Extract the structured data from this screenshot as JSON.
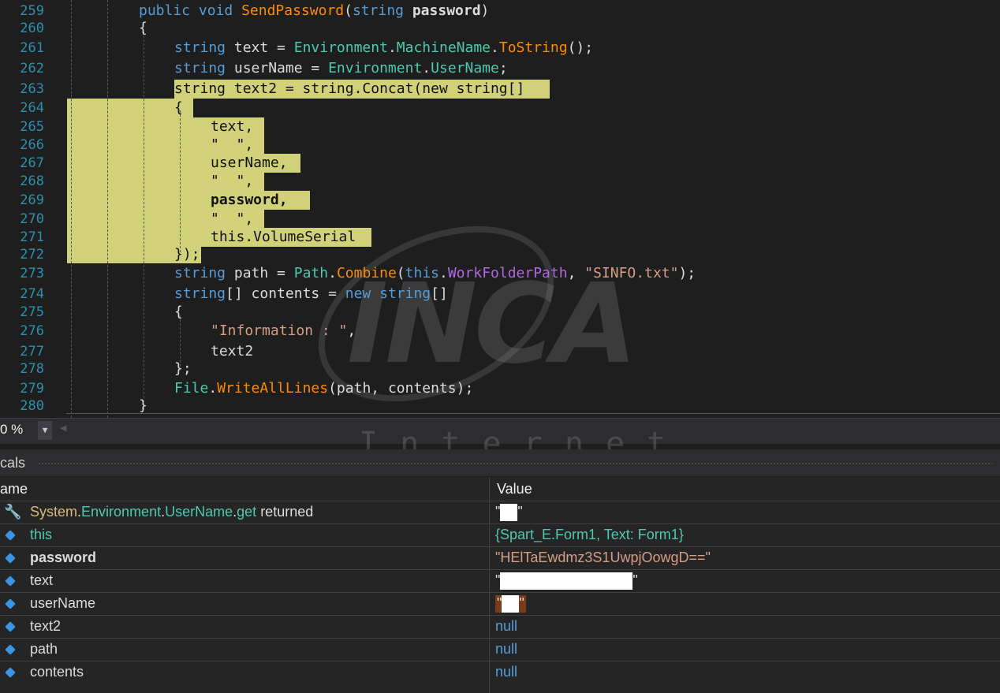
{
  "editor": {
    "lines": [
      {
        "n": "259"
      },
      {
        "n": "260"
      },
      {
        "n": "261"
      },
      {
        "n": "262"
      },
      {
        "n": "263"
      },
      {
        "n": "264"
      },
      {
        "n": "265"
      },
      {
        "n": "266"
      },
      {
        "n": "267"
      },
      {
        "n": "268"
      },
      {
        "n": "269"
      },
      {
        "n": "270"
      },
      {
        "n": "271"
      },
      {
        "n": "272"
      },
      {
        "n": "273"
      },
      {
        "n": "274"
      },
      {
        "n": "275"
      },
      {
        "n": "276"
      },
      {
        "n": "277"
      },
      {
        "n": "278"
      },
      {
        "n": "279"
      },
      {
        "n": "280"
      }
    ]
  },
  "watermark": {
    "logo": "INCA",
    "sub": "I.n.t.e.r.n.e.t"
  },
  "status": {
    "zoom": "0 %"
  },
  "locals": {
    "title": "cals",
    "col_name": "ame",
    "col_value": "Value",
    "rows": [
      {
        "name": "System.Environment.UserName.get returned",
        "value": "\"\""
      },
      {
        "name": "this",
        "value": "{Spart_E.Form1, Text: Form1}"
      },
      {
        "name": "password",
        "value": "\"HElTaEwdmz3S1UwpjOowgD==\""
      },
      {
        "name": "text",
        "value": "\"\""
      },
      {
        "name": "userName",
        "value": "\"\""
      },
      {
        "name": "text2",
        "value": "null"
      },
      {
        "name": "path",
        "value": "null"
      },
      {
        "name": "contents",
        "value": "null"
      }
    ]
  },
  "colors": {
    "highlight": "#d1d17a",
    "keyword": "#569cd6",
    "type": "#4ec9b0",
    "method": "#ff8c00",
    "string": "#d69d85",
    "null": "#569cd6",
    "this_value": "#4ec9b0"
  }
}
